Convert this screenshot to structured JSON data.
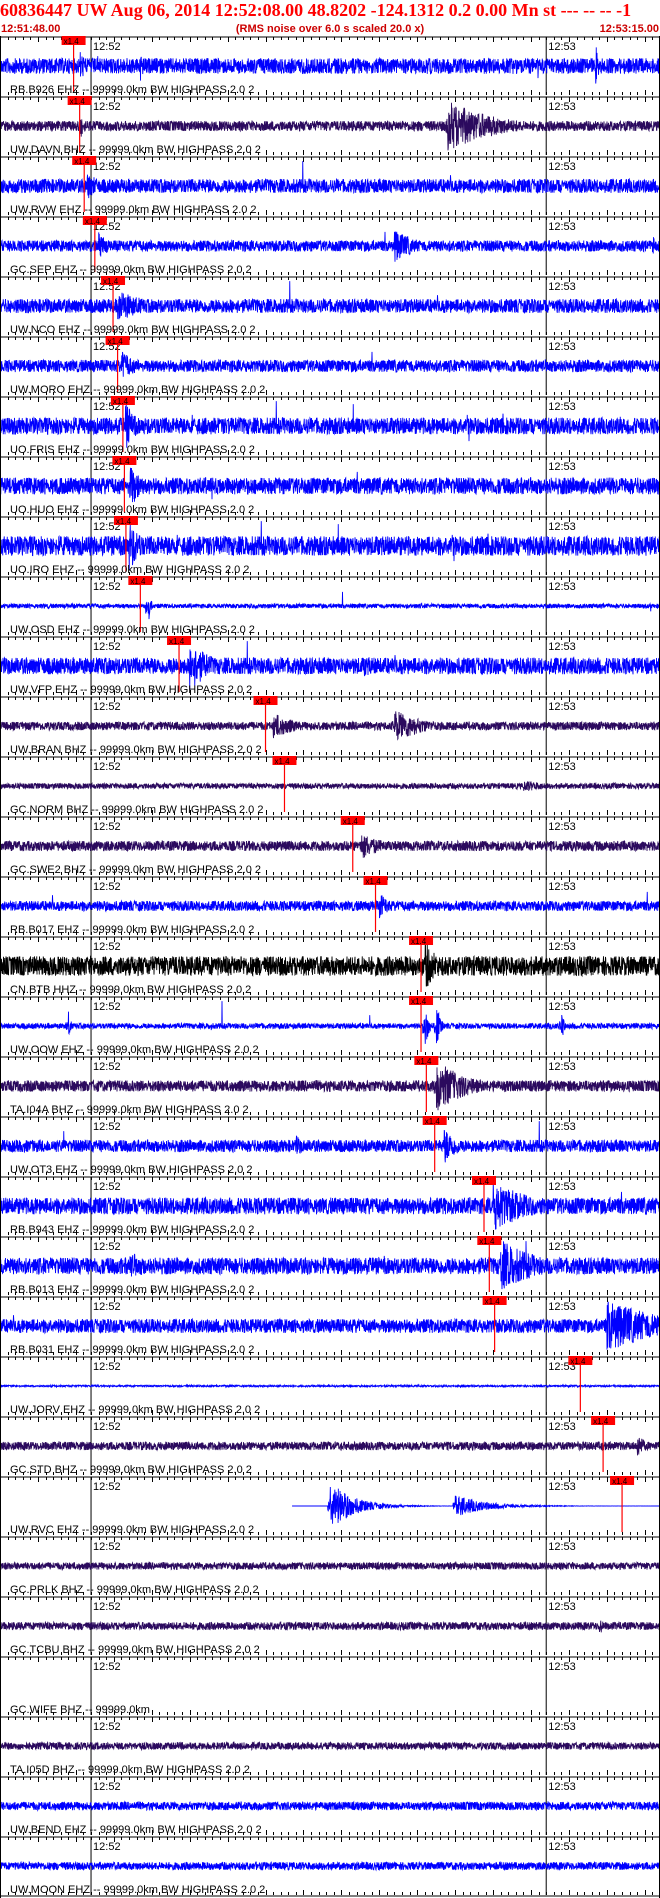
{
  "header": {
    "title": "60836447 UW Aug 06, 2014 12:52:08.00   48.8202 -124.1312  0.2 0.00 Mn st --- -- --   -1",
    "start_time": "12:51:48.00",
    "rms_note": "(RMS noise over 6.0 s scaled 20.0 x)",
    "end_time": "12:53:15.00"
  },
  "colors": {
    "header_red": "#ff0000",
    "pick_red": "#ff0000",
    "trace_blue": "#0000ff",
    "trace_purple": "#2b0a5e",
    "trace_black": "#000000",
    "grid": "#000000"
  },
  "chart_data": {
    "type": "line",
    "title": "60836447 UW Aug 06, 2014 12:52:08.00   48.8202 -124.1312  0.2 0.00 Mn st --- -- --   -1",
    "xlabel": "",
    "ylabel": "",
    "x_range_s": [
      0,
      87
    ],
    "x_start_label": "12:51:48.00",
    "x_end_label": "12:53:15.00",
    "minute_labels": [
      {
        "label": "12:52",
        "t": 12
      },
      {
        "label": "12:53",
        "t": 72
      }
    ],
    "pick_label": "x1.4",
    "series": [
      {
        "name": "RB.B926 EHZ -- 99999.0km BW  HIGHPASS  2.0  2",
        "color": "blue",
        "pick_t": 9.7,
        "amp": 0.28,
        "events": [
          {
            "t": 10.5,
            "a": 0.6,
            "w": 1
          },
          {
            "t": 18.5,
            "a": 0.9,
            "w": 0.3
          },
          {
            "t": 78.5,
            "a": 0.9,
            "w": 0.4
          }
        ],
        "bursts": 0.5
      },
      {
        "name": "UW.DAVN BHZ -- 99999.0km BW  HIGHPASS  2.0  2",
        "color": "purple",
        "pick_t": 10.5,
        "amp": 0.18,
        "events": [
          {
            "t": 10.5,
            "a": 0.5,
            "w": 0.8
          },
          {
            "t": 59,
            "a": 0.95,
            "w": 6
          }
        ],
        "bursts": 0
      },
      {
        "name": "UW.RVW EHZ -- 99999.0km BW  HIGHPASS  2.0  2",
        "color": "blue",
        "pick_t": 11.1,
        "amp": 0.25,
        "events": [
          {
            "t": 11.5,
            "a": 0.5,
            "w": 2
          }
        ],
        "bursts": 0.2
      },
      {
        "name": "GC.SEP EHZ -- 99999.0km BW  HIGHPASS  2.0  2",
        "color": "blue",
        "pick_t": 12.5,
        "amp": 0.2,
        "events": [
          {
            "t": 13,
            "a": 0.5,
            "w": 1.5
          },
          {
            "t": 52,
            "a": 0.6,
            "w": 3
          },
          {
            "t": 86,
            "a": 0.4,
            "w": 1
          }
        ],
        "bursts": 0.1
      },
      {
        "name": "UW.NCO EHZ -- 99999.0km BW  HIGHPASS  2.0  2",
        "color": "blue",
        "pick_t": 14.9,
        "amp": 0.25,
        "events": [
          {
            "t": 15.5,
            "a": 0.6,
            "w": 4
          }
        ],
        "bursts": 0.2
      },
      {
        "name": "UW.MORO EHZ -- 99999.0km BW  HIGHPASS  2.0  2",
        "color": "blue",
        "pick_t": 15.5,
        "amp": 0.22,
        "events": [
          {
            "t": 16,
            "a": 0.6,
            "w": 2
          }
        ],
        "bursts": 0.1
      },
      {
        "name": "UO.FRIS EHZ -- 99999.0km BW  HIGHPASS  2.0  2",
        "color": "blue",
        "pick_t": 16.2,
        "amp": 0.3,
        "events": [
          {
            "t": 16.5,
            "a": 0.9,
            "w": 1.5
          }
        ],
        "bursts": 0.9
      },
      {
        "name": "UO.HUO EHZ -- 99999.0km BW  HIGHPASS  2.0  2",
        "color": "blue",
        "pick_t": 16.4,
        "amp": 0.3,
        "events": [
          {
            "t": 17,
            "a": 0.95,
            "w": 1.5
          }
        ],
        "bursts": 0.95
      },
      {
        "name": "UO.IRO EHZ -- 99999.0km BW  HIGHPASS  2.0  2",
        "color": "blue",
        "pick_t": 16.6,
        "amp": 0.35,
        "events": [
          {
            "t": 17,
            "a": 0.9,
            "w": 2
          }
        ],
        "bursts": 1
      },
      {
        "name": "UW.OSD EHZ -- 99999.0km BW  HIGHPASS  2.0  2",
        "color": "blue",
        "pick_t": 18.5,
        "amp": 0.08,
        "events": [
          {
            "t": 19.5,
            "a": 0.9,
            "w": 0.3
          }
        ],
        "bursts": 0.3
      },
      {
        "name": "UW.VFP EHZ -- 99999.0km BW  HIGHPASS  2.0  2",
        "color": "blue",
        "pick_t": 23.6,
        "amp": 0.3,
        "events": [
          {
            "t": 25,
            "a": 0.9,
            "w": 3
          },
          {
            "t": 48,
            "a": 0.4,
            "w": 3
          }
        ],
        "bursts": 0.2
      },
      {
        "name": "UW.BRAN BHZ -- 99999.0km BW  HIGHPASS  2.0  2",
        "color": "purple",
        "pick_t": 35,
        "amp": 0.15,
        "events": [
          {
            "t": 36,
            "a": 0.5,
            "w": 3
          },
          {
            "t": 52,
            "a": 0.6,
            "w": 4
          }
        ],
        "bursts": 0
      },
      {
        "name": "GC.NORM BHZ -- 99999.0km BW  HIGHPASS  2.0  2",
        "color": "purple",
        "pick_t": 37.5,
        "amp": 0.1,
        "events": [
          {
            "t": 69,
            "a": 0.2,
            "w": 5
          }
        ],
        "bursts": 0
      },
      {
        "name": "GC.SWE2 BHZ -- 99999.0km BW  HIGHPASS  2.0  2",
        "color": "purple",
        "pick_t": 46.5,
        "amp": 0.18,
        "events": [
          {
            "t": 47.5,
            "a": 0.5,
            "w": 3
          }
        ],
        "bursts": 0
      },
      {
        "name": "RB.B017 EHZ -- 99999.0km BW  HIGHPASS  2.0  2",
        "color": "blue",
        "pick_t": 49.5,
        "amp": 0.18,
        "events": [
          {
            "t": 50,
            "a": 0.5,
            "w": 1.5
          }
        ],
        "bursts": 0.1
      },
      {
        "name": "CN.BTB HHZ -- 99999.0km BW  HIGHPASS  2.0  2",
        "color": "black",
        "pick_t": 55.5,
        "amp": 0.35,
        "events": [
          {
            "t": 56,
            "a": 0.9,
            "w": 2
          },
          {
            "t": 32,
            "a": 0.4,
            "w": 0.6
          }
        ],
        "bursts": 0
      },
      {
        "name": "UW.OOW EHZ -- 99999.0km BW  HIGHPASS  2.0  2",
        "color": "blue",
        "pick_t": 55.5,
        "amp": 0.1,
        "events": [
          {
            "t": 56,
            "a": 0.9,
            "w": 0.5
          },
          {
            "t": 57.5,
            "a": 0.9,
            "w": 0.5
          },
          {
            "t": 9,
            "a": 0.6,
            "w": 0.3
          },
          {
            "t": 74,
            "a": 0.7,
            "w": 0.3
          }
        ],
        "bursts": 0.2
      },
      {
        "name": "TA.I04A BHZ -- 99999.0km BW  HIGHPASS  2.0  2",
        "color": "purple",
        "pick_t": 56.2,
        "amp": 0.2,
        "events": [
          {
            "t": 57.5,
            "a": 0.95,
            "w": 4
          }
        ],
        "bursts": 0
      },
      {
        "name": "UW.OT3 EHZ -- 99999.0km BW  HIGHPASS  2.0  2",
        "color": "blue",
        "pick_t": 57.3,
        "amp": 0.22,
        "events": [
          {
            "t": 58.5,
            "a": 0.7,
            "w": 2
          },
          {
            "t": 39,
            "a": 0.4,
            "w": 1.5
          }
        ],
        "bursts": 0.2
      },
      {
        "name": "RB.B943 EHZ -- 99999.0km BW  HIGHPASS  2.0  2",
        "color": "blue",
        "pick_t": 63.8,
        "amp": 0.3,
        "events": [
          {
            "t": 65,
            "a": 0.95,
            "w": 5
          }
        ],
        "bursts": 0.3
      },
      {
        "name": "RB.B013 EHZ -- 99999.0km BW  HIGHPASS  2.0  2",
        "color": "blue",
        "pick_t": 64.5,
        "amp": 0.3,
        "events": [
          {
            "t": 66,
            "a": 0.95,
            "w": 5
          },
          {
            "t": 17,
            "a": 0.5,
            "w": 4
          }
        ],
        "bursts": 0.3
      },
      {
        "name": "RB.B031 EHZ -- 99999.0km BW  HIGHPASS  2.0  2",
        "color": "blue",
        "pick_t": 65.2,
        "amp": 0.25,
        "events": [
          {
            "t": 80,
            "a": 0.95,
            "w": 8
          }
        ],
        "bursts": 0.2
      },
      {
        "name": "UW.JORV EHZ -- 99999.0km BW  HIGHPASS  2.0  2",
        "color": "blue",
        "pick_t": 76.5,
        "amp": 0.03,
        "events": [],
        "bursts": 0
      },
      {
        "name": "GC.STD BHZ -- 99999.0km BW  HIGHPASS  2.0  2",
        "color": "purple",
        "pick_t": 79.5,
        "amp": 0.15,
        "events": [
          {
            "t": 84,
            "a": 0.5,
            "w": 1
          }
        ],
        "bursts": 0
      },
      {
        "name": "UW.RVC EHZ -- 99999.0km BW  HIGHPASS  2.0  2",
        "color": "blue",
        "pick_t": 82,
        "amp": 0.0,
        "start_t": 38.5,
        "events": [
          {
            "t": 43.5,
            "a": 0.9,
            "w": 3
          },
          {
            "t": 60,
            "a": 0.4,
            "w": 4
          }
        ],
        "bursts": 0.2
      },
      {
        "name": "GC.PRLK BHZ -- 99999.0km BW  HIGHPASS  2.0  2",
        "color": "purple",
        "pick_t": null,
        "amp": 0.13,
        "events": [],
        "bursts": 0
      },
      {
        "name": "GC.TCBU BHZ -- 99999.0km BW  HIGHPASS  2.0  2",
        "color": "purple",
        "pick_t": null,
        "amp": 0.14,
        "events": [
          {
            "t": 79,
            "a": 0.4,
            "w": 0.5
          }
        ],
        "bursts": 0
      },
      {
        "name": "GC.WIFE BHZ -- 99999.0km",
        "color": "purple",
        "pick_t": null,
        "amp": 0.0,
        "events": [],
        "bursts": 0
      },
      {
        "name": "TA.I05D BHZ -- 99999.0km BW  HIGHPASS  2.0  2",
        "color": "purple",
        "pick_t": null,
        "amp": 0.13,
        "events": [],
        "bursts": 0
      },
      {
        "name": "UW.BEND EHZ -- 99999.0km BW  HIGHPASS  2.0  2",
        "color": "blue",
        "pick_t": null,
        "amp": 0.15,
        "events": [],
        "bursts": 0
      },
      {
        "name": "UW.MOON EHZ -- 99999.0km BW  HIGHPASS  2.0  2",
        "color": "blue",
        "pick_t": null,
        "amp": 0.14,
        "events": [],
        "bursts": 0
      }
    ]
  }
}
